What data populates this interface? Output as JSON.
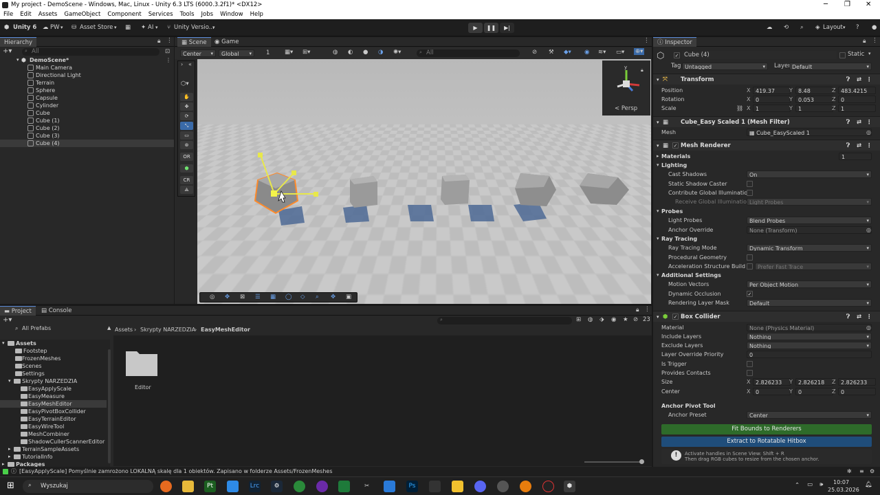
{
  "window": {
    "title": "My project - DemoScene - Windows, Mac, Linux - Unity 6.3 LTS (6000.3.2f1)* <DX12>"
  },
  "menu": [
    "File",
    "Edit",
    "Assets",
    "GameObject",
    "Component",
    "Services",
    "Tools",
    "Jobs",
    "Window",
    "Help"
  ],
  "toolbar": {
    "unity": "Unity 6",
    "pw": "PW",
    "asset_store": "Asset Store",
    "ai": "AI",
    "version_control": "Unity Versio...",
    "layout": "Layout"
  },
  "hierarchy": {
    "tab": "Hierarchy",
    "search_placeholder": "All",
    "scene": "DemoScene*",
    "items": [
      "Main Camera",
      "Directional Light",
      "Terrain",
      "Sphere",
      "Capsule",
      "Cylinder",
      "Cube",
      "Cube (1)",
      "Cube (2)",
      "Cube (3)",
      "Cube (4)"
    ]
  },
  "scene": {
    "tab_scene": "Scene",
    "tab_game": "Game",
    "pivot": "Center",
    "space": "Global",
    "grid_value": "1",
    "search_placeholder": "All",
    "persp": "< Persp",
    "tool_or": "OR",
    "tool_cr": "CR"
  },
  "inspector": {
    "tab": "Inspector",
    "object_name": "Cube (4)",
    "static": "Static",
    "tag_label": "Tag",
    "tag": "Untagged",
    "layer_label": "Layer",
    "layer": "Default",
    "transform": {
      "title": "Transform",
      "position_label": "Position",
      "rotation_label": "Rotation",
      "scale_label": "Scale",
      "position": {
        "x": "419.37",
        "y": "8.48",
        "z": "483.4215"
      },
      "rotation": {
        "x": "0",
        "y": "0.053",
        "z": "0"
      },
      "scale": {
        "x": "1",
        "y": "1",
        "z": "1"
      }
    },
    "mesh_filter": {
      "title": "Cube_Easy Scaled 1 (Mesh Filter)",
      "mesh_label": "Mesh",
      "mesh": "Cube_EasyScaled 1"
    },
    "mesh_renderer": {
      "title": "Mesh Renderer",
      "materials_label": "Materials",
      "materials_count": "1",
      "lighting": "Lighting",
      "cast_shadows_label": "Cast Shadows",
      "cast_shadows": "On",
      "static_shadow_caster": "Static Shadow Caster",
      "contribute_gi": "Contribute Global Illumination",
      "receive_gi_label": "Receive Global Illumination",
      "receive_gi": "Light Probes",
      "probes": "Probes",
      "light_probes_label": "Light Probes",
      "light_probes": "Blend Probes",
      "anchor_override_label": "Anchor Override",
      "anchor_override": "None (Transform)",
      "ray_tracing": "Ray Tracing",
      "ray_tracing_mode_label": "Ray Tracing Mode",
      "ray_tracing_mode": "Dynamic Transform",
      "procedural_geometry": "Procedural Geometry",
      "accel_label": "Acceleration Structure Build F",
      "accel": "Prefer Fast Trace",
      "additional": "Additional Settings",
      "motion_vectors_label": "Motion Vectors",
      "motion_vectors": "Per Object Motion",
      "dynamic_occlusion": "Dynamic Occlusion",
      "rendering_layer_label": "Rendering Layer Mask",
      "rendering_layer": "Default"
    },
    "box_collider": {
      "title": "Box Collider",
      "material_label": "Material",
      "material": "None (Physics Material)",
      "include_label": "Include Layers",
      "include": "Nothing",
      "exclude_label": "Exclude Layers",
      "exclude": "Nothing",
      "override_label": "Layer Override Priority",
      "override": "0",
      "is_trigger": "Is Trigger",
      "provides_contacts": "Provides Contacts",
      "size_label": "Size",
      "size": {
        "x": "2.826233",
        "y": "2.826218",
        "z": "2.826233"
      },
      "center_label": "Center",
      "center": {
        "x": "0",
        "y": "0",
        "z": "0"
      }
    },
    "anchor_pivot": {
      "title": "Anchor Pivot Tool",
      "preset_label": "Anchor Preset",
      "preset": "Center",
      "fit_button": "Fit Bounds to Renderers",
      "extract_button": "Extract to Rotatable Hitbox",
      "hint1": "Activate handles in Scene View: Shift + R",
      "hint2": "Then drag RGB cubes to resize from the chosen anchor."
    }
  },
  "project": {
    "tab_project": "Project",
    "tab_console": "Console",
    "all_prefabs": "All Prefabs",
    "count": "23",
    "breadcrumb": [
      "Assets",
      "Skrypty NARZEDZIA",
      "EasyMeshEditor"
    ],
    "tree": [
      {
        "label": "Assets",
        "indent": 0
      },
      {
        "label": "Footstep",
        "indent": 1
      },
      {
        "label": "FrozenMeshes",
        "indent": 1
      },
      {
        "label": "Scenes",
        "indent": 1
      },
      {
        "label": "Settings",
        "indent": 1
      },
      {
        "label": "Skrypty NARZEDZIA",
        "indent": 1
      },
      {
        "label": "EasyApplyScale",
        "indent": 2
      },
      {
        "label": "EasyMeasure",
        "indent": 2
      },
      {
        "label": "EasyMeshEditor",
        "indent": 2
      },
      {
        "label": "EasyPivotBoxCollider",
        "indent": 2
      },
      {
        "label": "EasyTerrainEditor",
        "indent": 2
      },
      {
        "label": "EasyWireTool",
        "indent": 2
      },
      {
        "label": "MeshCombiner",
        "indent": 2
      },
      {
        "label": "ShadowCullerScannerEditor",
        "indent": 2
      },
      {
        "label": "TerrainSampleAssets",
        "indent": 1
      },
      {
        "label": "TutorialInfo",
        "indent": 1
      },
      {
        "label": "Packages",
        "indent": 0
      }
    ],
    "folder_item": "Editor"
  },
  "status": {
    "message": "[EasyApplyScale] Pomyślnie zamrożono LOKALNĄ skalę dla 1 obiektów. Zapisano w folderze Assets/FrozenMeshes"
  },
  "taskbar": {
    "search": "Wyszukaj",
    "time": "10:07",
    "date": "25.03.2026"
  }
}
